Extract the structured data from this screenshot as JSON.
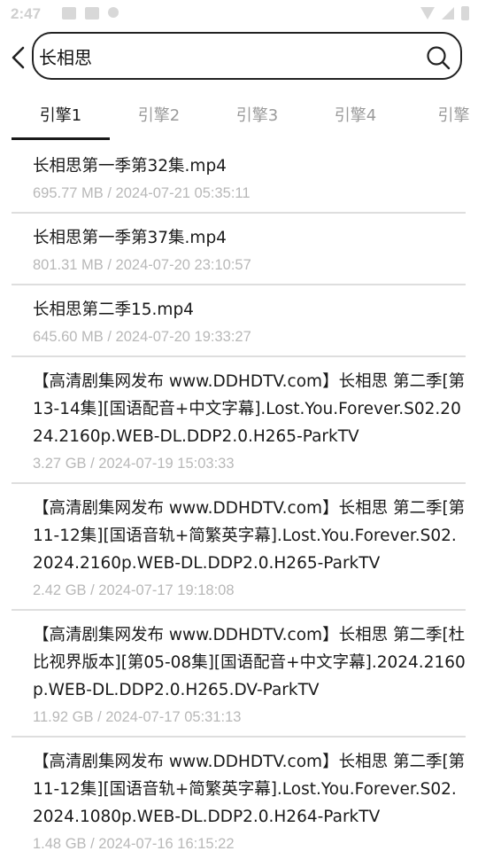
{
  "status_bar": {
    "time": "2:47"
  },
  "search": {
    "query": "长相思",
    "back_icon": "chevron-left-icon",
    "search_icon": "search-icon"
  },
  "tabs": [
    {
      "label": "引擎1",
      "active": true
    },
    {
      "label": "引擎2",
      "active": false
    },
    {
      "label": "引擎3",
      "active": false
    },
    {
      "label": "引擎4",
      "active": false
    },
    {
      "label": "引擎",
      "active": false
    }
  ],
  "results": [
    {
      "title": "长相思第一季第32集.mp4",
      "size": "695.77 MB",
      "date": "2024-07-21 05:35:11",
      "meta": "695.77 MB / 2024-07-21 05:35:11"
    },
    {
      "title": "长相思第一季第37集.mp4",
      "size": "801.31 MB",
      "date": "2024-07-20 23:10:57",
      "meta": "801.31 MB / 2024-07-20 23:10:57"
    },
    {
      "title": "长相思第二季15.mp4",
      "size": "645.60 MB",
      "date": "2024-07-20 19:33:27",
      "meta": "645.60 MB / 2024-07-20 19:33:27"
    },
    {
      "title": "【高清剧集网发布 www.DDHDTV.com】长相思 第二季[第13-14集][国语配音+中文字幕].Lost.You.Forever.S02.2024.2160p.WEB-DL.DDP2.0.H265-ParkTV",
      "size": "3.27 GB",
      "date": "2024-07-19 15:03:33",
      "meta": "3.27 GB / 2024-07-19 15:03:33"
    },
    {
      "title": "【高清剧集网发布 www.DDHDTV.com】长相思 第二季[第11-12集][国语音轨+简繁英字幕].Lost.You.Forever.S02.2024.2160p.WEB-DL.DDP2.0.H265-ParkTV",
      "size": "2.42 GB",
      "date": "2024-07-17 19:18:08",
      "meta": "2.42 GB / 2024-07-17 19:18:08"
    },
    {
      "title": "【高清剧集网发布 www.DDHDTV.com】长相思 第二季[杜比视界版本][第05-08集][国语配音+中文字幕].2024.2160p.WEB-DL.DDP2.0.H265.DV-ParkTV",
      "size": "11.92 GB",
      "date": "2024-07-17 05:31:13",
      "meta": "11.92 GB / 2024-07-17 05:31:13"
    },
    {
      "title": "【高清剧集网发布 www.DDHDTV.com】长相思 第二季[第11-12集][国语音轨+简繁英字幕].Lost.You.Forever.S02.2024.1080p.WEB-DL.DDP2.0.H264-ParkTV",
      "size": "1.48 GB",
      "date": "2024-07-16 16:15:22",
      "meta": "1.48 GB / 2024-07-16 16:15:22"
    }
  ]
}
